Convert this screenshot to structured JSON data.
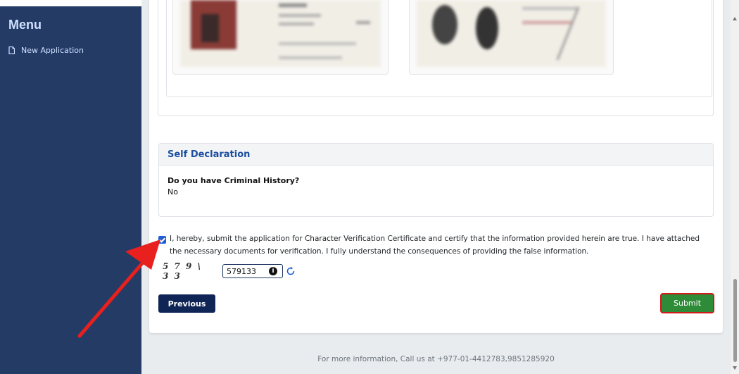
{
  "sidebar": {
    "title": "Menu",
    "items": [
      {
        "label": "New Application",
        "icon": "document-icon"
      }
    ]
  },
  "declaration": {
    "heading": "Self Declaration",
    "question": "Do you have Criminal History?",
    "answer": "No"
  },
  "agreement": {
    "checked": true,
    "text": "I, hereby, submit the application for Character Verification Certificate and certify that the information provided herein are true. I have attached the necessary documents for verification. I fully understand the consequences of providing the false information."
  },
  "captcha": {
    "image_text": "5 7 9 \\ 3 3",
    "input_value": "579133"
  },
  "buttons": {
    "previous": "Previous",
    "submit": "Submit"
  },
  "footer": {
    "text": "For more information, Call us at +977-01-4412783,9851285920"
  },
  "colors": {
    "sidebar_bg": "#243b66",
    "header_text": "#1d4fa0",
    "submit_bg": "#2e8b37",
    "submit_border": "#d11a1a",
    "previous_bg": "#0f2555",
    "annotation_arrow": "#e8201e"
  }
}
